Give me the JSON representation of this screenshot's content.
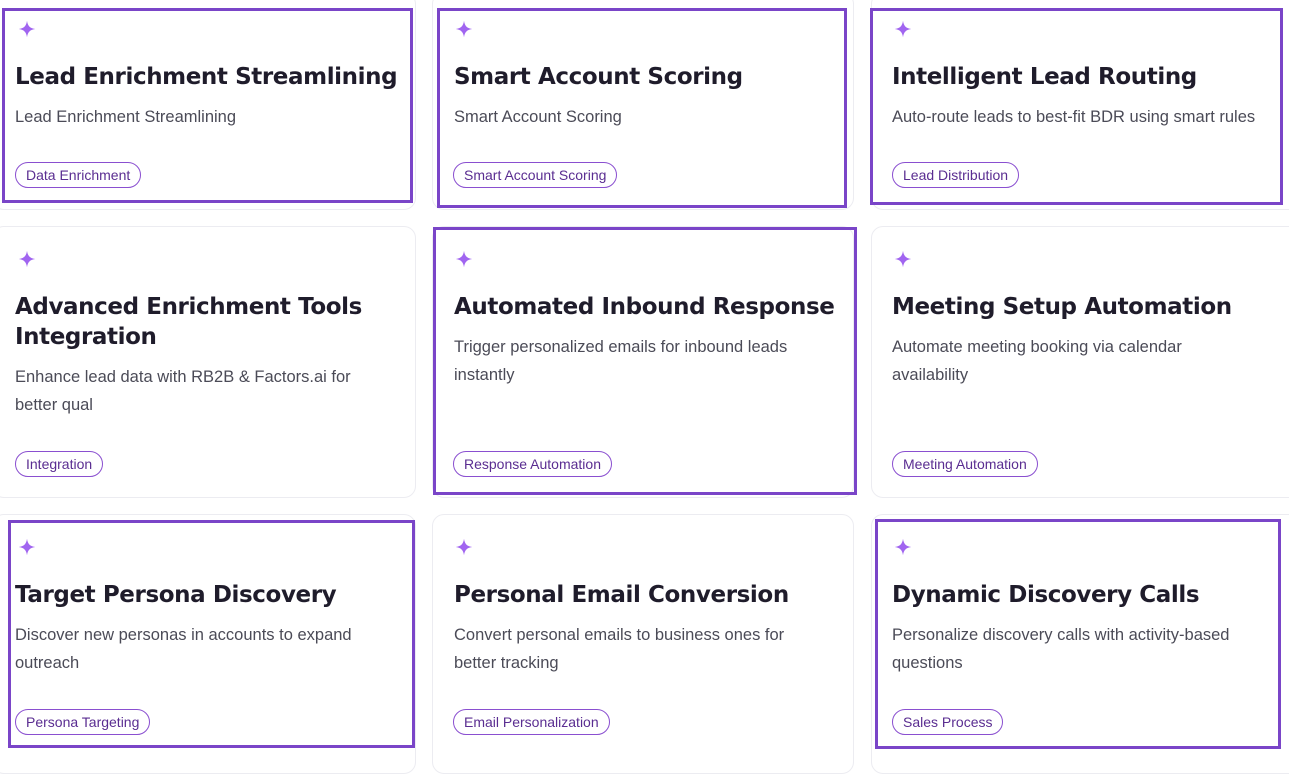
{
  "cards": [
    {
      "title": "Lead Enrichment Streamlining",
      "description": "Lead Enrichment Streamlining",
      "tag": "Data Enrichment"
    },
    {
      "title": "Smart Account Scoring",
      "description": "Smart Account Scoring",
      "tag": "Smart Account Scoring"
    },
    {
      "title": "Intelligent Lead Routing",
      "description": "Auto-route leads to best-fit BDR using smart rules",
      "tag": "Lead Distribution"
    },
    {
      "title": "Advanced Enrichment Tools Integration",
      "description": "Enhance lead data with RB2B & Factors.ai for better qual",
      "tag": "Integration"
    },
    {
      "title": "Automated Inbound Response",
      "description": "Trigger personalized emails for inbound leads instantly",
      "tag": "Response Automation"
    },
    {
      "title": "Meeting Setup Automation",
      "description": "Automate meeting booking via calendar availability",
      "tag": "Meeting Automation"
    },
    {
      "title": "Target Persona Discovery",
      "description": "Discover new personas in accounts to expand outreach",
      "tag": "Persona Targeting"
    },
    {
      "title": "Personal Email Conversion",
      "description": "Convert personal emails to business ones for better tracking",
      "tag": "Email Personalization"
    },
    {
      "title": "Dynamic Discovery Calls",
      "description": "Personalize discovery calls with activity-based questions",
      "tag": "Sales Process"
    }
  ],
  "colors": {
    "accent": "#7a45c8",
    "sparkle": "#a165f0",
    "tag_text": "#5a2d91",
    "title": "#1f1c2b",
    "description": "#4b4b57"
  },
  "icons": {
    "card_icon": "sparkle-icon"
  }
}
